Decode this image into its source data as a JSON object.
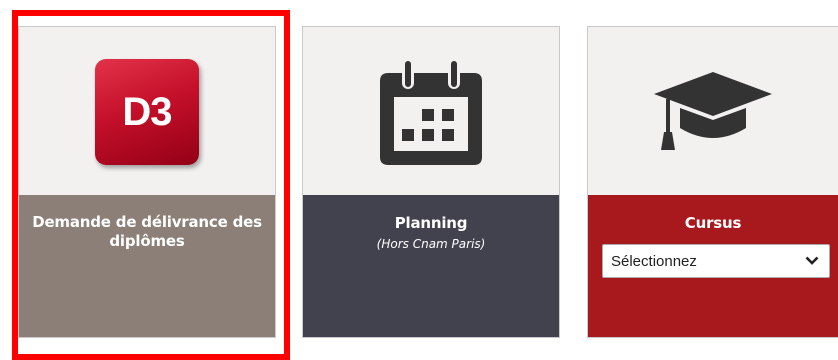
{
  "cards": [
    {
      "logo_text": "D3",
      "title": "Demande de délivrance des diplômes"
    },
    {
      "icon": "calendar-icon",
      "title": "Planning",
      "subtitle": "(Hors Cnam Paris)"
    },
    {
      "icon": "graduation-cap-icon",
      "title": "Cursus",
      "select": {
        "selected": "Sélectionnez"
      }
    }
  ],
  "colors": {
    "card_top": "#f2f1f0",
    "diplome_bottom": "#8b7f78",
    "planning_bottom": "#42424f",
    "cursus_bottom": "#a8191d",
    "highlight": "#ff0000",
    "icon": "#333333"
  }
}
